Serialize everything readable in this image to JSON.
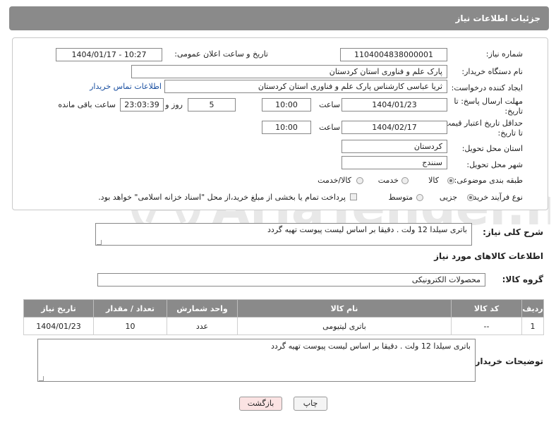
{
  "header": {
    "title": "جزئیات اطلاعات نیاز"
  },
  "form": {
    "need_number": {
      "label": "شماره نیاز:",
      "value": "1104004838000001"
    },
    "announce_datetime": {
      "label": "تاریخ و ساعت اعلان عمومی:",
      "value": "1404/01/17 - 10:27"
    },
    "buyer_org": {
      "label": "نام دستگاه خریدار:",
      "value": "پارک علم و فناوری استان کردستان"
    },
    "requester": {
      "label": "ایجاد کننده درخواست:",
      "value": "ثریا عباسی کارشناس پارک علم و فناوری استان کردستان",
      "contact_link": "اطلاعات تماس خریدار"
    },
    "deadline": {
      "label_line1": "مهلت ارسال پاسخ: تا",
      "label_line2": "تاریخ:",
      "date": "1404/01/23",
      "time_label": "ساعت",
      "time": "10:00",
      "days": "5",
      "days_label": "روز و",
      "remaining": "23:03:39",
      "remaining_label": "ساعت باقی مانده"
    },
    "price_validity": {
      "label_line1": "حداقل تاریخ اعتبار قیمت:",
      "label_line2": "تا تاریخ:",
      "date": "1404/02/17",
      "time_label": "ساعت",
      "time": "10:00"
    },
    "delivery_province": {
      "label": "استان محل تحویل:",
      "value": "کردستان"
    },
    "delivery_city": {
      "label": "شهر محل تحویل:",
      "value": "سنندج"
    },
    "category": {
      "label": "طبقه بندی موضوعی:",
      "options": [
        "کالا",
        "خدمت",
        "کالا/خدمت"
      ],
      "selected": "کالا"
    },
    "process_type": {
      "label": "نوع فرآیند خرید :",
      "options": [
        "جزیی",
        "متوسط"
      ],
      "selected": "جزیی",
      "payment_note": "پرداخت تمام یا بخشی از مبلغ خرید،از محل \"اسناد خزانه اسلامی\" خواهد بود."
    }
  },
  "description": {
    "label": "شرح کلی نیاز:",
    "value": "باتری سیلدا 12 ولت . دقیقا بر اساس لیست پیوست تهیه گردد"
  },
  "goods_section": {
    "title": "اطلاعات کالاهای مورد نیاز"
  },
  "goods_group": {
    "label": "گروه کالا:",
    "value": "محصولات الکترونیکی"
  },
  "table": {
    "headers": [
      "ردیف",
      "کد کالا",
      "نام کالا",
      "واحد شمارش",
      "تعداد / مقدار",
      "تاریخ نیاز"
    ],
    "rows": [
      {
        "index": "1",
        "code": "--",
        "name": "باتری لیتیومی",
        "unit": "عدد",
        "qty": "10",
        "date": "1404/01/23"
      }
    ]
  },
  "buyer_notes": {
    "label": "توضیحات خریدار:",
    "value": "باتری سیلدا 12 ولت . دقیقا بر اساس لیست پیوست تهیه گردد"
  },
  "buttons": {
    "print": "چاپ",
    "back": "بازگشت"
  },
  "watermark": {
    "text": "AriaTender.neT"
  },
  "colors": {
    "header_bg": "#8a8a8a",
    "link": "#1a4fa0",
    "back_button_bg": "#fbe3e3"
  }
}
